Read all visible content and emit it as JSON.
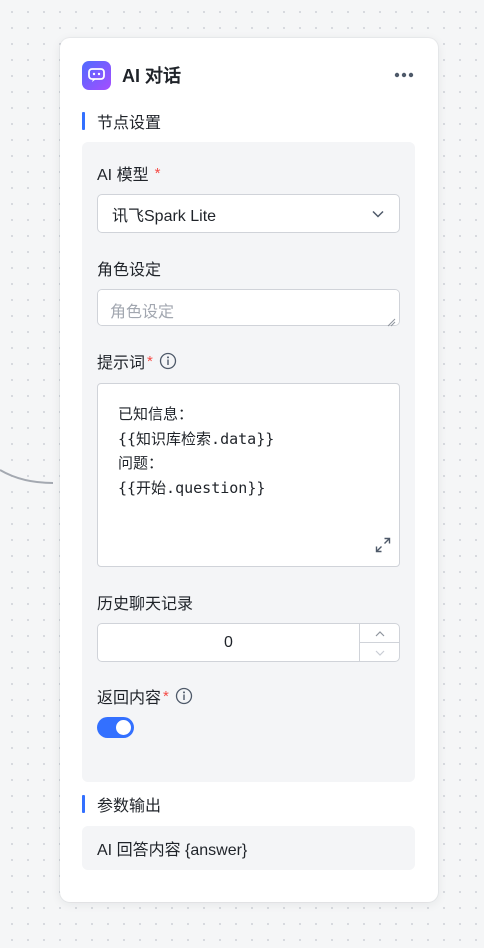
{
  "node": {
    "title": "AI 对话",
    "icon": "chat-bot-icon"
  },
  "sections": {
    "settings_title": "节点设置",
    "output_title": "参数输出"
  },
  "fields": {
    "model": {
      "label": "AI 模型",
      "required_mark": "*",
      "value": "讯飞Spark Lite"
    },
    "role": {
      "label": "角色设定",
      "placeholder": "角色设定",
      "value": ""
    },
    "prompt": {
      "label": "提示词",
      "required_mark": "*",
      "lines": [
        "已知信息：",
        "{{知识库检索.data}}",
        "问题：",
        "{{开始.question}}"
      ]
    },
    "history": {
      "label": "历史聊天记录",
      "value": "0"
    },
    "return_content": {
      "label": "返回内容",
      "required_mark": "*",
      "enabled": true
    }
  },
  "output": {
    "text": "AI 回答内容 {answer}"
  },
  "colors": {
    "accent": "#3370ff",
    "required": "#f54a45",
    "panel": "#f4f5f7"
  }
}
